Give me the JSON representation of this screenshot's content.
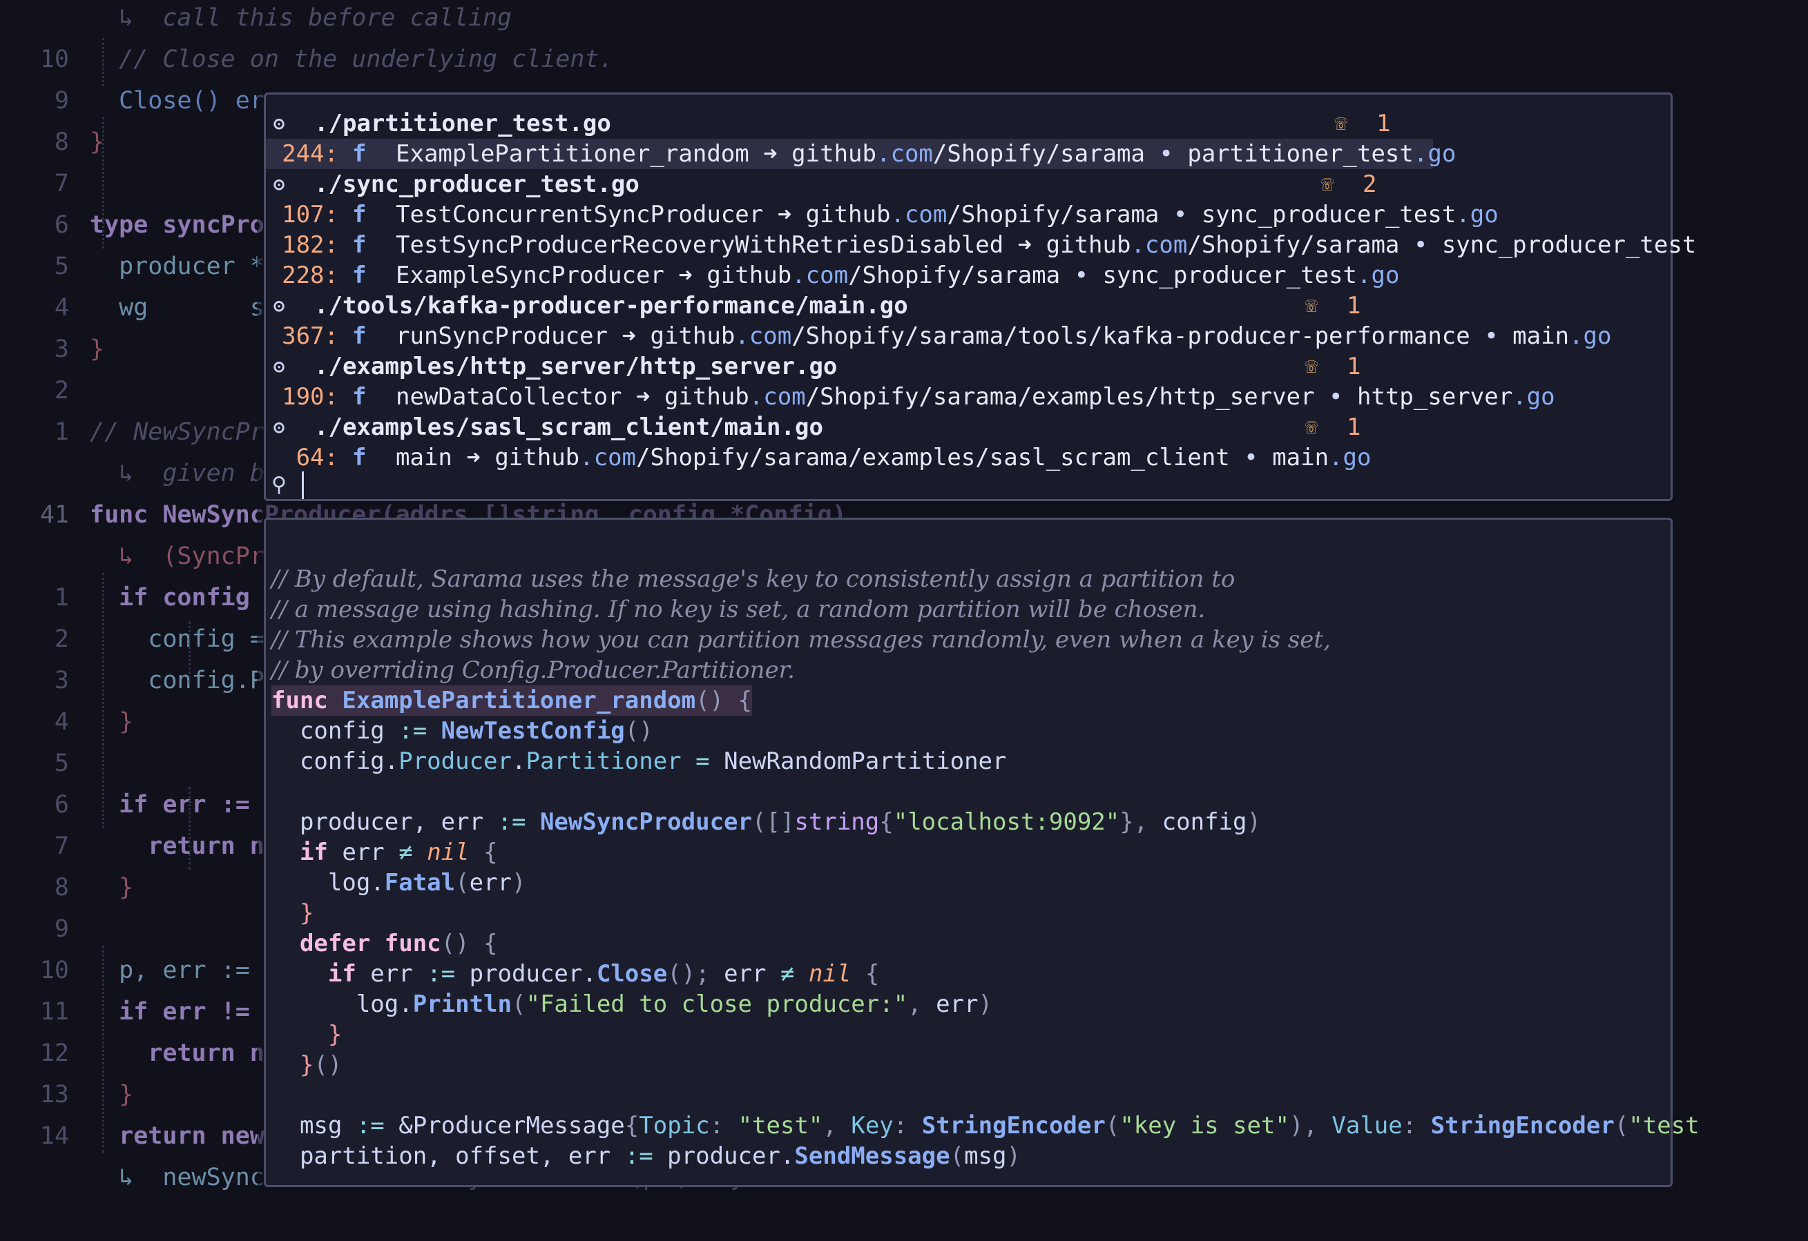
{
  "background_editor": {
    "lines": [
      {
        "num": "",
        "text": "  ↳  call this before calling",
        "cls": "cm"
      },
      {
        "num": "10",
        "text": "  // Close on the underlying client.",
        "cls": "cm"
      },
      {
        "num": "9",
        "text": "  Close() error",
        "cls": "fn"
      },
      {
        "num": "8",
        "text": "}",
        "cls": "rd"
      },
      {
        "num": "7",
        "text": "",
        "cls": ""
      },
      {
        "num": "6",
        "text": "type syncProducer struct {",
        "cls": "k"
      },
      {
        "num": "5",
        "text": "  producer *asyncProducer",
        "cls": "ty"
      },
      {
        "num": "4",
        "text": "  wg       sync.WaitGroup",
        "cls": "ty"
      },
      {
        "num": "3",
        "text": "}",
        "cls": "rd"
      },
      {
        "num": "2",
        "text": "",
        "cls": ""
      },
      {
        "num": "1",
        "text": "// NewSyncProducer creates a new SyncProducer using the",
        "cls": "cm"
      },
      {
        "num": "",
        "text": "  ↳  given broker addresses and configuration.",
        "cls": "cm"
      },
      {
        "num": "41",
        "text": "func NewSyncProducer(addrs []string, config *Config)",
        "cls": "k",
        "cur": true
      },
      {
        "num": "",
        "text": "  ↳  (SyncProducer, error) {",
        "cls": "rd"
      },
      {
        "num": "1",
        "text": "  if config == nil {",
        "cls": "k"
      },
      {
        "num": "2",
        "text": "    config = NewConfig()",
        "cls": "ty"
      },
      {
        "num": "3",
        "text": "    config.Producer.Return.Successes = true",
        "cls": "ty"
      },
      {
        "num": "4",
        "text": "  }",
        "cls": "rd"
      },
      {
        "num": "5",
        "text": "",
        "cls": ""
      },
      {
        "num": "6",
        "text": "  if err := verifyProducerConfig(config); err != nil {",
        "cls": "k"
      },
      {
        "num": "7",
        "text": "    return nil, err",
        "cls": "k"
      },
      {
        "num": "8",
        "text": "  }",
        "cls": "rd"
      },
      {
        "num": "9",
        "text": "",
        "cls": ""
      },
      {
        "num": "10",
        "text": "  p, err := NewAsyncProducer(addrs, config)",
        "cls": "ty"
      },
      {
        "num": "11",
        "text": "  if err != nil {",
        "cls": "k"
      },
      {
        "num": "12",
        "text": "    return nil, err",
        "cls": "k"
      },
      {
        "num": "13",
        "text": "  }",
        "cls": "rd"
      },
      {
        "num": "14",
        "text": "  return newSyncProducerFromAsyncProducer(p.(*asyncProducer)), nil",
        "cls": "k"
      },
      {
        "num": "",
        "text": "  ↳  newSyncProducerFromAsyncProducer(p.(*asyncProd",
        "cls": "ty"
      }
    ]
  },
  "results": {
    "groups": [
      {
        "file": "./partitioner_test.go",
        "count": "1",
        "items": [
          {
            "line": "244:",
            "name": "ExamplePartitioner_random",
            "pkg": "github",
            "dom": ".com",
            "path": "/Shopify/sarama",
            "file": "partitioner_test",
            "ext": ".go",
            "selected": true
          }
        ]
      },
      {
        "file": "./sync_producer_test.go",
        "count": "2",
        "items": [
          {
            "line": "107:",
            "name": "TestConcurrentSyncProducer",
            "pkg": "github",
            "dom": ".com",
            "path": "/Shopify/sarama",
            "file": "sync_producer_test",
            "ext": ".go"
          },
          {
            "line": "182:",
            "name": "TestSyncProducerRecoveryWithRetriesDisabled",
            "pkg": "github",
            "dom": ".com",
            "path": "/Shopify/sarama",
            "file": "sync_producer_test",
            "ext": ""
          },
          {
            "line": "228:",
            "name": "ExampleSyncProducer",
            "pkg": "github",
            "dom": ".com",
            "path": "/Shopify/sarama",
            "file": "sync_producer_test",
            "ext": ".go"
          }
        ]
      },
      {
        "file": "./tools/kafka-producer-performance/main.go",
        "count": "1",
        "items": [
          {
            "line": "367:",
            "name": "runSyncProducer",
            "pkg": "github",
            "dom": ".com",
            "path": "/Shopify/sarama/tools/kafka-producer-performance",
            "file": "main",
            "ext": ".go"
          }
        ]
      },
      {
        "file": "./examples/http_server/http_server.go",
        "count": "1",
        "items": [
          {
            "line": "190:",
            "name": "newDataCollector",
            "pkg": "github",
            "dom": ".com",
            "path": "/Shopify/sarama/examples/http_server",
            "file": "http_server",
            "ext": ".go"
          }
        ]
      },
      {
        "file": "./examples/sasl_scram_client/main.go",
        "count": "1",
        "items": [
          {
            "line": "64:",
            "name": "main",
            "pkg": "github",
            "dom": ".com",
            "path": "/Shopify/sarama/examples/sasl_scram_client",
            "file": "main",
            "ext": ".go"
          }
        ]
      }
    ],
    "search_value": ""
  },
  "preview": {
    "comments": [
      "// By default, Sarama uses the message's key to consistently assign a partition to",
      "// a message using hashing. If no key is set, a random partition will be chosen.",
      "// This example shows how you can partition messages randomly, even when a key is set,",
      "// by overriding Config.Producer.Partitioner."
    ],
    "code": [
      [
        [
          "pkw",
          "func "
        ],
        [
          "pfn",
          "ExamplePartitioner_random"
        ],
        [
          "pun",
          "() {"
        ]
      ],
      [
        [
          "pid",
          "  config "
        ],
        [
          "pop",
          ":="
        ],
        [
          "pid",
          " "
        ],
        [
          "pfn",
          "NewTestConfig"
        ],
        [
          "pun",
          "()"
        ]
      ],
      [
        [
          "pid",
          "  config."
        ],
        [
          "pfld",
          "Producer"
        ],
        [
          "pid",
          "."
        ],
        [
          "pfld",
          "Partitioner"
        ],
        [
          "pid",
          " "
        ],
        [
          "pop",
          "="
        ],
        [
          "pid",
          " NewRandomPartitioner"
        ]
      ],
      [],
      [
        [
          "pid",
          "  producer, err "
        ],
        [
          "pop",
          ":="
        ],
        [
          "pid",
          " "
        ],
        [
          "pfn",
          "NewSyncProducer"
        ],
        [
          "pun",
          "([]"
        ],
        [
          "pty",
          "string"
        ],
        [
          "pun",
          "{"
        ],
        [
          "pstr",
          "\"localhost:9092\""
        ],
        [
          "pun",
          "}, "
        ],
        [
          "pid",
          "config"
        ],
        [
          "pun",
          ")"
        ]
      ],
      [
        [
          "pkw",
          "  if "
        ],
        [
          "pid",
          "err "
        ],
        [
          "pop",
          "≠"
        ],
        [
          "pid",
          " "
        ],
        [
          "pnil",
          "nil"
        ],
        [
          "pun",
          " {"
        ]
      ],
      [
        [
          "pid",
          "    log."
        ],
        [
          "pfn",
          "Fatal"
        ],
        [
          "pun",
          "("
        ],
        [
          "pid",
          "err"
        ],
        [
          "pun",
          ")"
        ]
      ],
      [
        [
          "pbr",
          "  }"
        ]
      ],
      [
        [
          "pkw",
          "  defer func"
        ],
        [
          "pun",
          "() {"
        ]
      ],
      [
        [
          "pkw",
          "    if "
        ],
        [
          "pid",
          "err "
        ],
        [
          "pop",
          ":="
        ],
        [
          "pid",
          " producer."
        ],
        [
          "pfn",
          "Close"
        ],
        [
          "pun",
          "(); "
        ],
        [
          "pid",
          "err "
        ],
        [
          "pop",
          "≠"
        ],
        [
          "pid",
          " "
        ],
        [
          "pnil",
          "nil"
        ],
        [
          "pun",
          " {"
        ]
      ],
      [
        [
          "pid",
          "      log."
        ],
        [
          "pfn",
          "Println"
        ],
        [
          "pun",
          "("
        ],
        [
          "pstr",
          "\"Failed to close producer:\""
        ],
        [
          "pun",
          ", "
        ],
        [
          "pid",
          "err"
        ],
        [
          "pun",
          ")"
        ]
      ],
      [
        [
          "pbr",
          "    }"
        ]
      ],
      [
        [
          "pbr",
          "  }"
        ],
        [
          "pun",
          "()"
        ]
      ],
      [],
      [
        [
          "pid",
          "  msg "
        ],
        [
          "pop",
          ":="
        ],
        [
          "pid",
          " &ProducerMessage"
        ],
        [
          "pun",
          "{"
        ],
        [
          "pfld",
          "Topic"
        ],
        [
          "pun",
          ": "
        ],
        [
          "pstr",
          "\"test\""
        ],
        [
          "pun",
          ", "
        ],
        [
          "pfld",
          "Key"
        ],
        [
          "pun",
          ": "
        ],
        [
          "pfn",
          "StringEncoder"
        ],
        [
          "pun",
          "("
        ],
        [
          "pstr",
          "\"key is set\""
        ],
        [
          "pun",
          "), "
        ],
        [
          "pfld",
          "Value"
        ],
        [
          "pun",
          ": "
        ],
        [
          "pfn",
          "StringEncoder"
        ],
        [
          "pun",
          "("
        ],
        [
          "pstr",
          "\"test"
        ]
      ],
      [
        [
          "pid",
          "  partition, offset, err "
        ],
        [
          "pop",
          ":="
        ],
        [
          "pid",
          " producer."
        ],
        [
          "pfn",
          "SendMessage"
        ],
        [
          "pun",
          "("
        ],
        [
          "pid",
          "msg"
        ],
        [
          "pun",
          ")"
        ]
      ]
    ]
  },
  "icons": {
    "gopher": "gopher-icon",
    "calls": "incoming-calls-icon",
    "function": "function-icon",
    "search": "search-icon"
  }
}
